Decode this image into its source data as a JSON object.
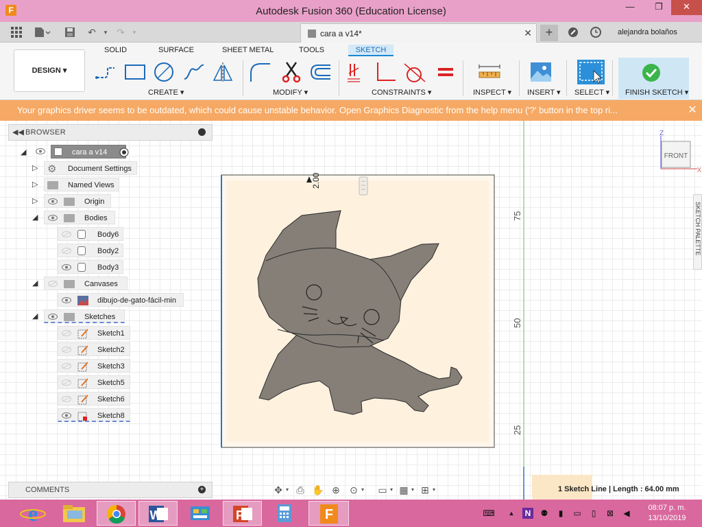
{
  "window": {
    "title": "Autodesk Fusion 360 (Education License)",
    "app_icon": "F"
  },
  "tabstrip": {
    "doc_tab": "cara a v14*",
    "user": "alejandra bolaños"
  },
  "ribbon": {
    "workspace": "DESIGN ▾",
    "tabs": [
      "SOLID",
      "SURFACE",
      "SHEET METAL",
      "TOOLS",
      "SKETCH"
    ],
    "active_tab": "SKETCH",
    "groups": {
      "create": "CREATE ▾",
      "modify": "MODIFY ▾",
      "constraints": "CONSTRAINTS ▾",
      "inspect": "INSPECT ▾",
      "insert": "INSERT ▾",
      "select": "SELECT ▾",
      "finish": "FINISH SKETCH ▾"
    }
  },
  "warning": {
    "text": "Your graphics driver seems to be outdated, which could cause unstable behavior. Open Graphics Diagnostic from the help menu ('?' button in the top ri...",
    "close": "✕"
  },
  "browser": {
    "title": "BROWSER",
    "root": "cara a v14",
    "items": [
      {
        "label": "Document Settings",
        "icon": "gear-icon"
      },
      {
        "label": "Named Views",
        "icon": "folder-icon"
      },
      {
        "label": "Origin",
        "icon": "folder-icon"
      },
      {
        "label": "Bodies",
        "icon": "folder-icon"
      },
      {
        "label": "Body6",
        "icon": "body-icon"
      },
      {
        "label": "Body2",
        "icon": "body-icon"
      },
      {
        "label": "Body3",
        "icon": "body-icon"
      },
      {
        "label": "Canvases",
        "icon": "folder-icon"
      },
      {
        "label": "dibujo-de-gato-fácil-min",
        "icon": "canvas-image-icon"
      },
      {
        "label": "Sketches",
        "icon": "folder-icon"
      },
      {
        "label": "Sketch1",
        "icon": "sketch-icon"
      },
      {
        "label": "Sketch2",
        "icon": "sketch-icon"
      },
      {
        "label": "Sketch3",
        "icon": "sketch-icon"
      },
      {
        "label": "Sketch5",
        "icon": "sketch-icon"
      },
      {
        "label": "Sketch6",
        "icon": "sketch-icon"
      },
      {
        "label": "Sketch8",
        "icon": "sketch-icon"
      }
    ]
  },
  "comments": {
    "title": "COMMENTS"
  },
  "canvas": {
    "dimension": "2.00",
    "axis_labels": [
      "75",
      "50",
      "25"
    ],
    "viewcube": {
      "face": "FRONT",
      "z": "Z",
      "x": "X"
    },
    "palette_tab": "SKETCH PALETTE"
  },
  "status": {
    "text": "1 Sketch Line | Length : 64.00 mm"
  },
  "taskbar": {
    "time": "08:07 p. m.",
    "date": "13/10/2019"
  },
  "colors": {
    "title_bar": "#e9a0c8",
    "warning": "#f6a964",
    "accent_blue": "#1a86d4",
    "cat_fill": "#857f78",
    "taskbar": "#d9689e"
  }
}
